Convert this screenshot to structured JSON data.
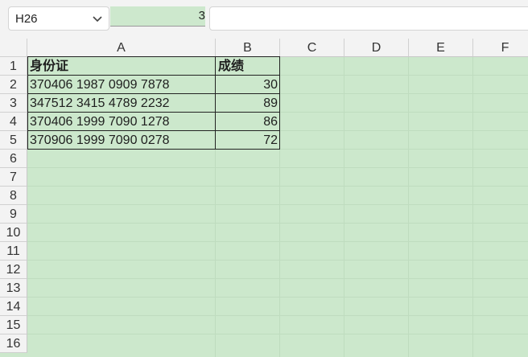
{
  "formula_bar": {
    "name_box": "H26",
    "cell_preview": "3",
    "formula": ""
  },
  "columns": [
    "A",
    "B",
    "C",
    "D",
    "E",
    "F"
  ],
  "rows": [
    "1",
    "2",
    "3",
    "4",
    "5",
    "6",
    "7",
    "8",
    "9",
    "10",
    "11",
    "12",
    "13",
    "14",
    "15",
    "16"
  ],
  "table": {
    "headers": [
      "身份证",
      "成绩"
    ],
    "rows": [
      [
        "370406 1987 0909 7878",
        "30"
      ],
      [
        "347512 3415 4789 2232",
        "89"
      ],
      [
        "370406 1999 7090 1278",
        "86"
      ],
      [
        "370906 1999 7090 0278",
        "72"
      ]
    ]
  },
  "colors": {
    "sheet_fill": "#cce8cc",
    "header_bg": "#f3f3f3"
  },
  "icons": {
    "name_box_dropdown": "chevron-down-icon"
  }
}
